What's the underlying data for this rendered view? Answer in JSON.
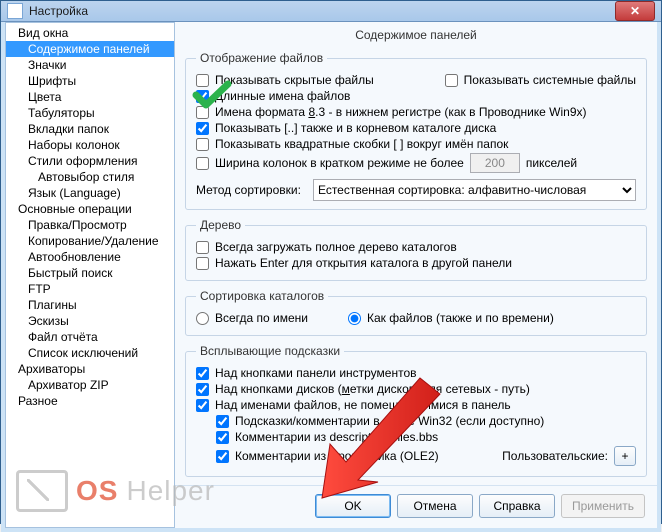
{
  "window": {
    "title": "Настройка",
    "close": "✕"
  },
  "sidebar": {
    "items": [
      {
        "label": "Вид окна",
        "indent": 0
      },
      {
        "label": "Содержимое панелей",
        "indent": 1,
        "selected": true
      },
      {
        "label": "Значки",
        "indent": 1
      },
      {
        "label": "Шрифты",
        "indent": 1
      },
      {
        "label": "Цвета",
        "indent": 1
      },
      {
        "label": "Табуляторы",
        "indent": 1
      },
      {
        "label": "Вкладки папок",
        "indent": 1
      },
      {
        "label": "Наборы колонок",
        "indent": 1
      },
      {
        "label": "Стили оформления",
        "indent": 1
      },
      {
        "label": "Автовыбор стиля",
        "indent": 2
      },
      {
        "label": "Язык (Language)",
        "indent": 1
      },
      {
        "label": "Основные операции",
        "indent": 0
      },
      {
        "label": "Правка/Просмотр",
        "indent": 1
      },
      {
        "label": "Копирование/Удаление",
        "indent": 1
      },
      {
        "label": "Автообновление",
        "indent": 1
      },
      {
        "label": "Быстрый поиск",
        "indent": 1
      },
      {
        "label": "FTP",
        "indent": 1
      },
      {
        "label": "Плагины",
        "indent": 1
      },
      {
        "label": "Эскизы",
        "indent": 1
      },
      {
        "label": "Файл отчёта",
        "indent": 1
      },
      {
        "label": "Список исключений",
        "indent": 1
      },
      {
        "label": "Архиваторы",
        "indent": 0
      },
      {
        "label": "Архиватор ZIP",
        "indent": 1
      },
      {
        "label": "Разное",
        "indent": 0
      }
    ]
  },
  "main": {
    "title": "Содержимое панелей",
    "files_group": "Отображение файлов",
    "cb_hidden": "Показывать скрытые файлы",
    "cb_system": "Показывать системные файлы",
    "cb_long_pre": "Д",
    "cb_long_post": "линные имена файлов",
    "cb_83_pre": "Имена формата ",
    "cb_83_u": "8",
    "cb_83_post": ".3 - в нижнем регистре (как в Проводнике Win9x)",
    "cb_dotdot": "Показывать [..] также и в корневом каталоге диска",
    "cb_brackets": "Показывать квадратные скобки [ ] вокруг имён папок",
    "cb_width_pre": "Ширина колонок в кратком режиме не более",
    "cb_width_val": "200",
    "cb_width_suf": "пикселей",
    "sort_label": "Метод сортировки:",
    "sort_sel": "Естественная сортировка: алфавитно-числовая",
    "tree_group": "Дерево",
    "cb_tree_full": "Всегда загружать полное дерево каталогов",
    "cb_tree_enter": "Нажать Enter для открытия каталога в другой панели",
    "sortdir_group": "Сортировка каталогов",
    "rb_byname": "Всегда по имени",
    "rb_asfiles": "Как файлов (также и по времени)",
    "tips_group": "Всплывающие подсказки",
    "cb_tip_toolbar": "Над кнопками панели инструментов",
    "cb_tip_drives_pre": "Над кнопками дисков (",
    "cb_tip_drives_u": "м",
    "cb_tip_drives_mid": "етки дисков, для сетевых - путь)",
    "cb_tip_files_pre": "Над именами файлов, не помещающимися в панель",
    "cb_tip_win32": "Подсказки/комментарии в стиле Win32 (если доступно)",
    "cb_tip_descript": "Комментарии из descript.ion/files.bbs",
    "cb_tip_ole2": "Комментарии из Проводника (OLE2)",
    "custom_label": "Пользовательские:",
    "plus": "+"
  },
  "buttons": {
    "ok": "OK",
    "cancel": "Отмена",
    "help": "Справка",
    "apply": "Применить"
  },
  "watermark": {
    "t1": "OS",
    "t2": "Helper"
  }
}
